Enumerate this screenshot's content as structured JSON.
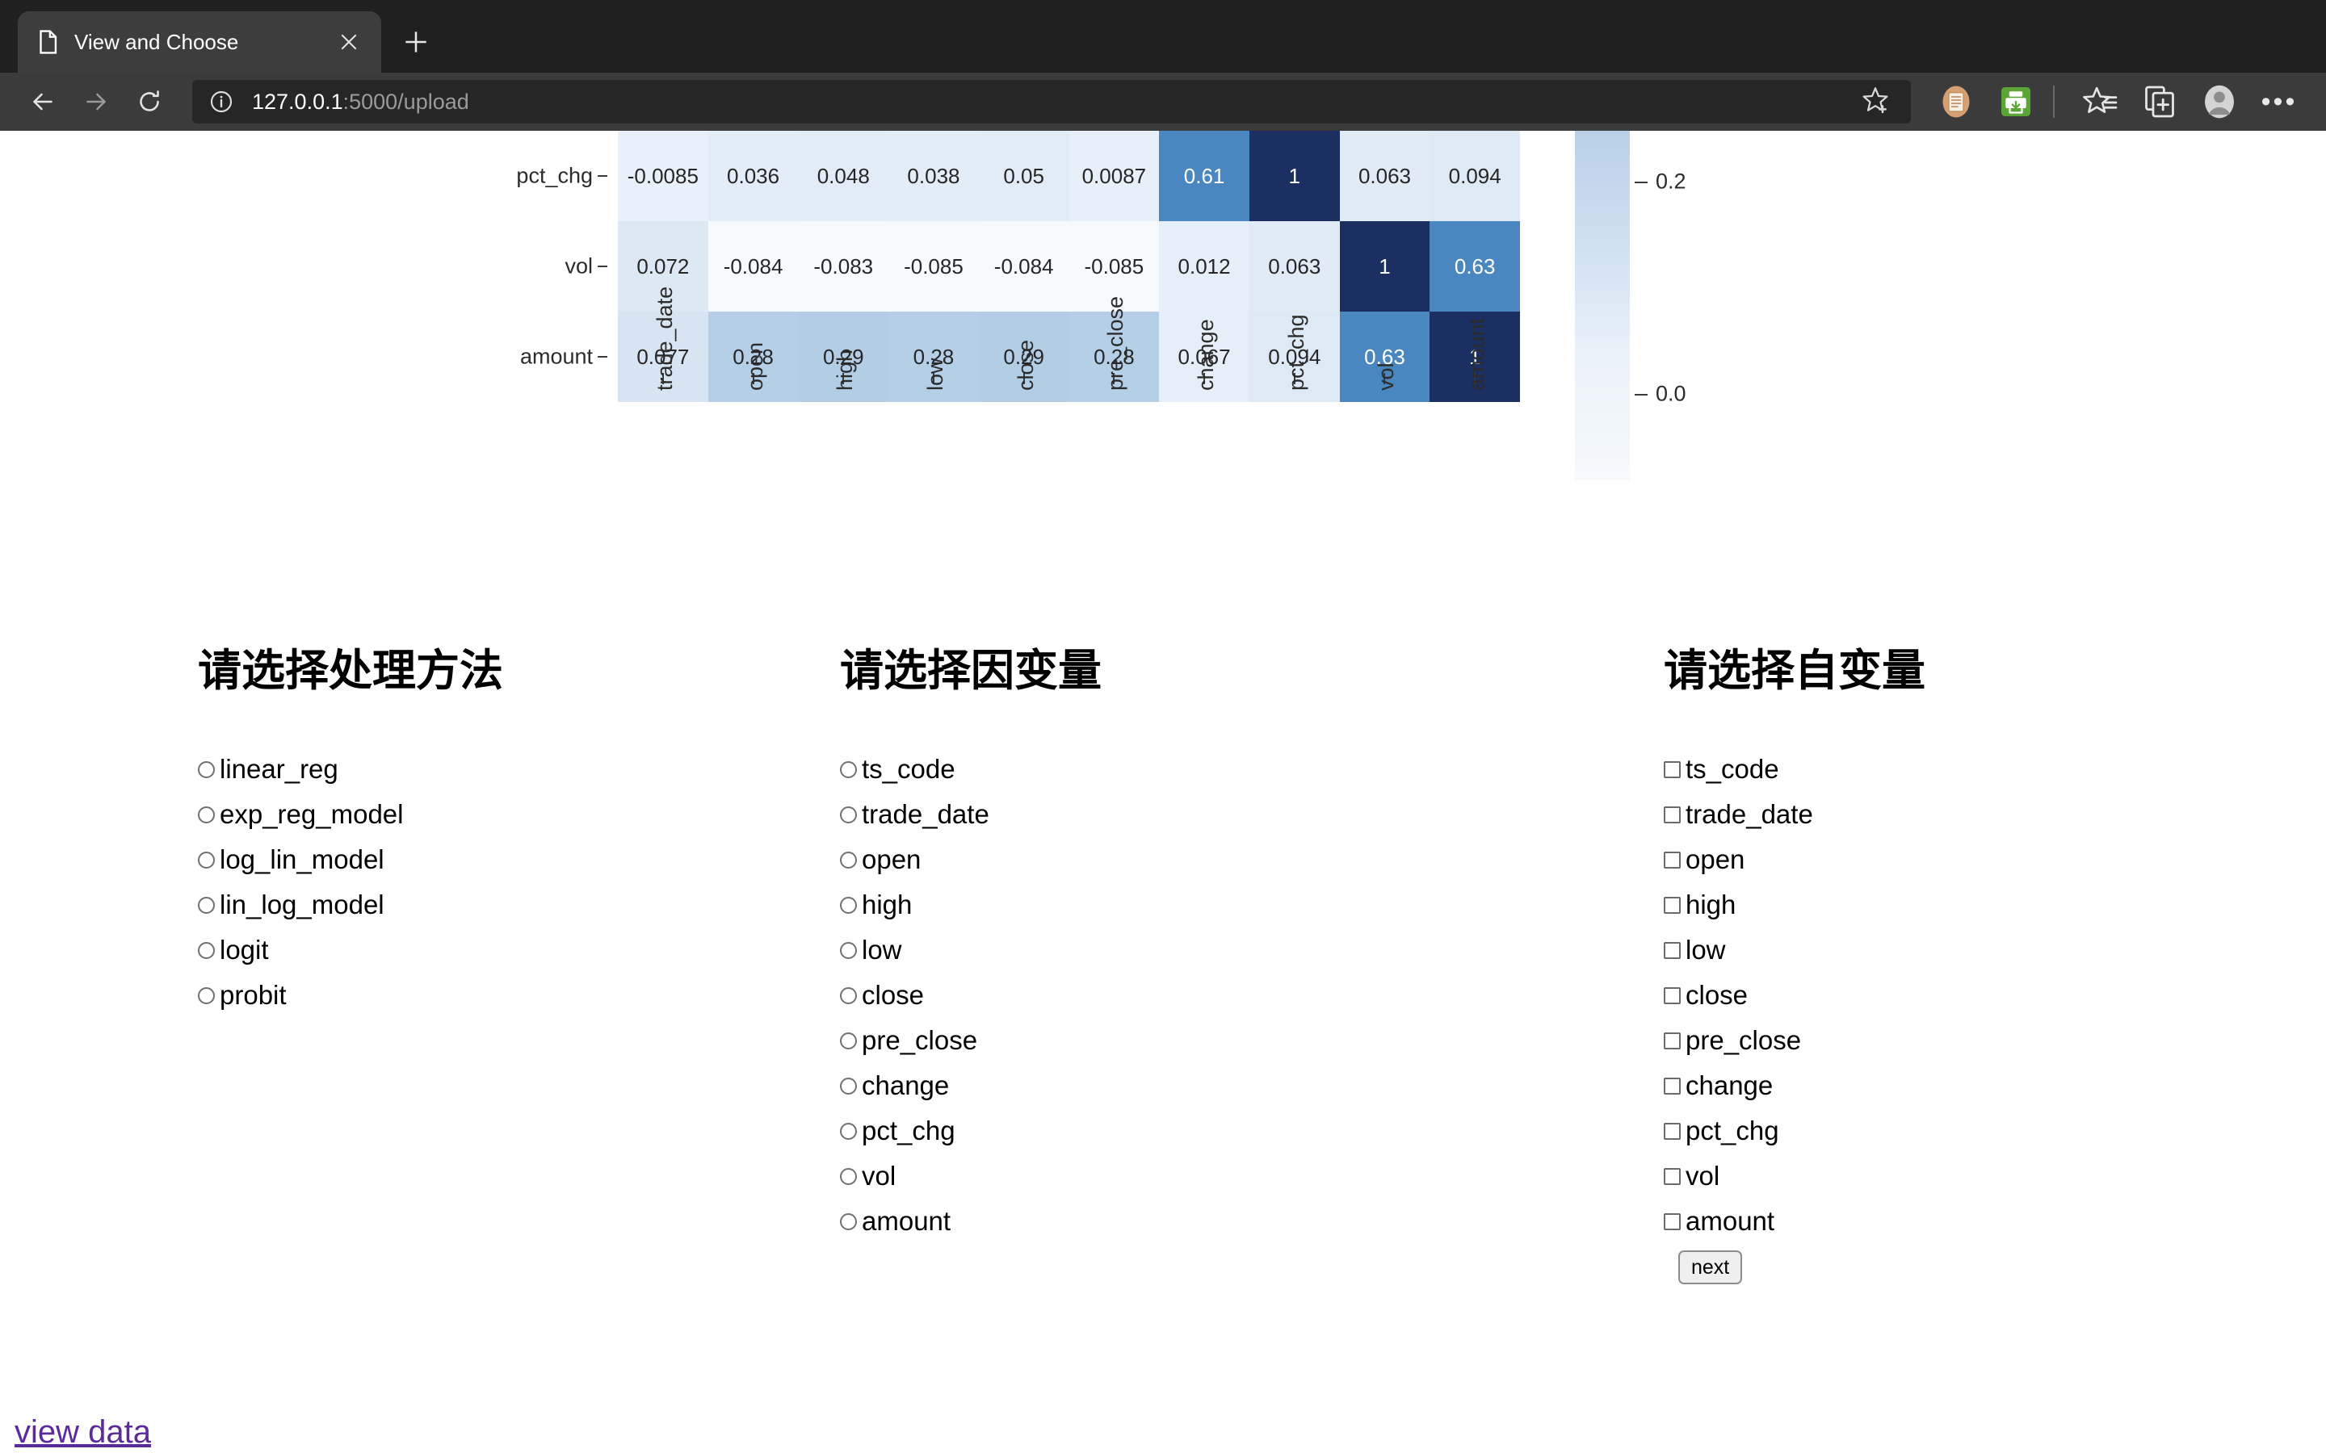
{
  "browser": {
    "tab": {
      "title": "View and Choose",
      "favicon_icon": "page-icon",
      "close_icon": "close-icon"
    },
    "new_tab_icon": "plus-icon",
    "nav": {
      "back_icon": "back-arrow-icon",
      "forward_icon": "forward-arrow-icon",
      "reload_icon": "reload-icon"
    },
    "address": {
      "info_icon": "info-circle-icon",
      "host": "127.0.0.1",
      "path": ":5000/upload",
      "favorite_icon": "star-add-icon"
    },
    "toolbar_icons": [
      {
        "name": "reading-list-icon",
        "label": "Reading list"
      },
      {
        "name": "printer-icon",
        "label": "Print"
      },
      {
        "name": "favorites-icon",
        "label": "Favorites"
      },
      {
        "name": "collections-icon",
        "label": "Collections"
      },
      {
        "name": "profile-avatar-icon",
        "label": "Profile"
      },
      {
        "name": "more-options-icon",
        "label": "Settings and more"
      }
    ]
  },
  "chart_data": {
    "type": "heatmap",
    "title": "",
    "xlabel": "",
    "ylabel": "",
    "note": "Correlation matrix heatmap, scrolled so only the last three rows are visible; the top row is clipped.",
    "colormap": "Blues",
    "colorbar": {
      "position": "right",
      "ticks": [
        "0.2",
        "0.0"
      ],
      "tick_values": [
        0.2,
        0.0
      ]
    },
    "x_categories": [
      "trade_date",
      "open",
      "high",
      "low",
      "close",
      "pre_close",
      "change",
      "pct_chg",
      "vol",
      "amount"
    ],
    "y_categories": [
      "pct_chg",
      "vol",
      "amount"
    ],
    "annotations": [
      [
        "-0.0085",
        "0.036",
        "0.048",
        "0.038",
        "0.05",
        "0.0087",
        "0.61",
        "1",
        "0.063",
        "0.094"
      ],
      [
        "0.072",
        "-0.084",
        "-0.083",
        "-0.085",
        "-0.084",
        "-0.085",
        "0.012",
        "0.063",
        "1",
        "0.63"
      ],
      [
        "0.077",
        "0.28",
        "0.29",
        "0.28",
        "0.29",
        "0.28",
        "0.067",
        "0.094",
        "0.63",
        "1"
      ]
    ],
    "values": [
      [
        -0.0085,
        0.036,
        0.048,
        0.038,
        0.05,
        0.0087,
        0.61,
        1,
        0.063,
        0.094
      ],
      [
        0.072,
        -0.084,
        -0.083,
        -0.085,
        -0.084,
        -0.085,
        0.012,
        0.063,
        1,
        0.63
      ],
      [
        0.077,
        0.28,
        0.29,
        0.28,
        0.29,
        0.28,
        0.067,
        0.094,
        0.63,
        1
      ]
    ],
    "cell_colors": [
      [
        "#e8f0f9",
        "#e3edf7",
        "#e2ecf7",
        "#e3edf7",
        "#e2ecf7",
        "#e7eff9",
        "#4a87c0",
        "#1b2f63",
        "#e0ebf6",
        "#dde9f5"
      ],
      [
        "#dce8f4",
        "#f6fafd",
        "#f6fafd",
        "#f6fafd",
        "#f6fafd",
        "#f6fafd",
        "#e6eff8",
        "#e0ebf6",
        "#1b2f63",
        "#4a87c0"
      ],
      [
        "#d7e4f2",
        "#b5cfe6",
        "#b3cde5",
        "#b5cfe6",
        "#b3cde5",
        "#b5cfe6",
        "#e6eff8",
        "#dde9f5",
        "#4a87c0",
        "#1b2f63"
      ]
    ],
    "dark_text_cells": [
      [
        0,
        6
      ],
      [
        0,
        7
      ],
      [
        1,
        8
      ],
      [
        1,
        9
      ],
      [
        2,
        8
      ],
      [
        2,
        9
      ]
    ]
  },
  "form": {
    "columns": [
      {
        "heading": "请选择处理方法",
        "input_type": "radio",
        "options": [
          {
            "label": "linear_reg"
          },
          {
            "label": "exp_reg_model"
          },
          {
            "label": "log_lin_model"
          },
          {
            "label": "lin_log_model"
          },
          {
            "label": "logit"
          },
          {
            "label": "probit"
          }
        ]
      },
      {
        "heading": "请选择因变量",
        "input_type": "radio",
        "options": [
          {
            "label": "ts_code"
          },
          {
            "label": "trade_date"
          },
          {
            "label": "open"
          },
          {
            "label": "high"
          },
          {
            "label": "low"
          },
          {
            "label": "close"
          },
          {
            "label": "pre_close"
          },
          {
            "label": "change"
          },
          {
            "label": "pct_chg"
          },
          {
            "label": "vol"
          },
          {
            "label": "amount"
          }
        ]
      },
      {
        "heading": "请选择自变量",
        "input_type": "checkbox",
        "options": [
          {
            "label": "ts_code"
          },
          {
            "label": "trade_date"
          },
          {
            "label": "open"
          },
          {
            "label": "high"
          },
          {
            "label": "low"
          },
          {
            "label": "close"
          },
          {
            "label": "pre_close"
          },
          {
            "label": "change"
          },
          {
            "label": "pct_chg"
          },
          {
            "label": "vol"
          },
          {
            "label": "amount"
          }
        ],
        "submit_label": "next"
      }
    ],
    "view_data_link": "view data"
  },
  "colors": {
    "link_visited": "#5b2b9b",
    "heatmap_max": "#1b2f63",
    "heatmap_mid": "#4a87c0",
    "chrome_toolbar": "#3b3b3b",
    "chrome_tabstrip": "#202020"
  }
}
